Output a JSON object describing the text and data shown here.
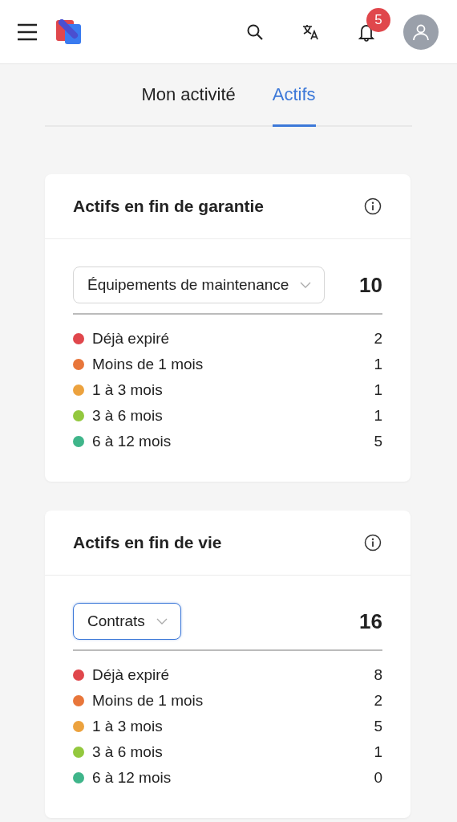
{
  "header": {
    "notification_count": "5"
  },
  "tabs": [
    {
      "label": "Mon activité",
      "selected": false
    },
    {
      "label": "Actifs",
      "selected": true
    }
  ],
  "cards": [
    {
      "title": "Actifs en fin de garantie",
      "filter": {
        "value": "Équipements de maintenance",
        "focused": false
      },
      "total": "10",
      "rows": [
        {
          "label": "Déjà expiré",
          "count": "2",
          "color": "#e0474c"
        },
        {
          "label": "Moins de 1 mois",
          "count": "1",
          "color": "#e8763a"
        },
        {
          "label": "1 à 3 mois",
          "count": "1",
          "color": "#eca23e"
        },
        {
          "label": "3 à 6 mois",
          "count": "1",
          "color": "#93c83e"
        },
        {
          "label": "6 à 12 mois",
          "count": "5",
          "color": "#3fb58a"
        }
      ]
    },
    {
      "title": "Actifs en fin de vie",
      "filter": {
        "value": "Contrats",
        "focused": true
      },
      "total": "16",
      "rows": [
        {
          "label": "Déjà expiré",
          "count": "8",
          "color": "#e0474c"
        },
        {
          "label": "Moins de 1 mois",
          "count": "2",
          "color": "#e8763a"
        },
        {
          "label": "1 à 3 mois",
          "count": "5",
          "color": "#eca23e"
        },
        {
          "label": "3 à 6 mois",
          "count": "1",
          "color": "#93c83e"
        },
        {
          "label": "6 à 12 mois",
          "count": "0",
          "color": "#3fb58a"
        }
      ]
    }
  ]
}
